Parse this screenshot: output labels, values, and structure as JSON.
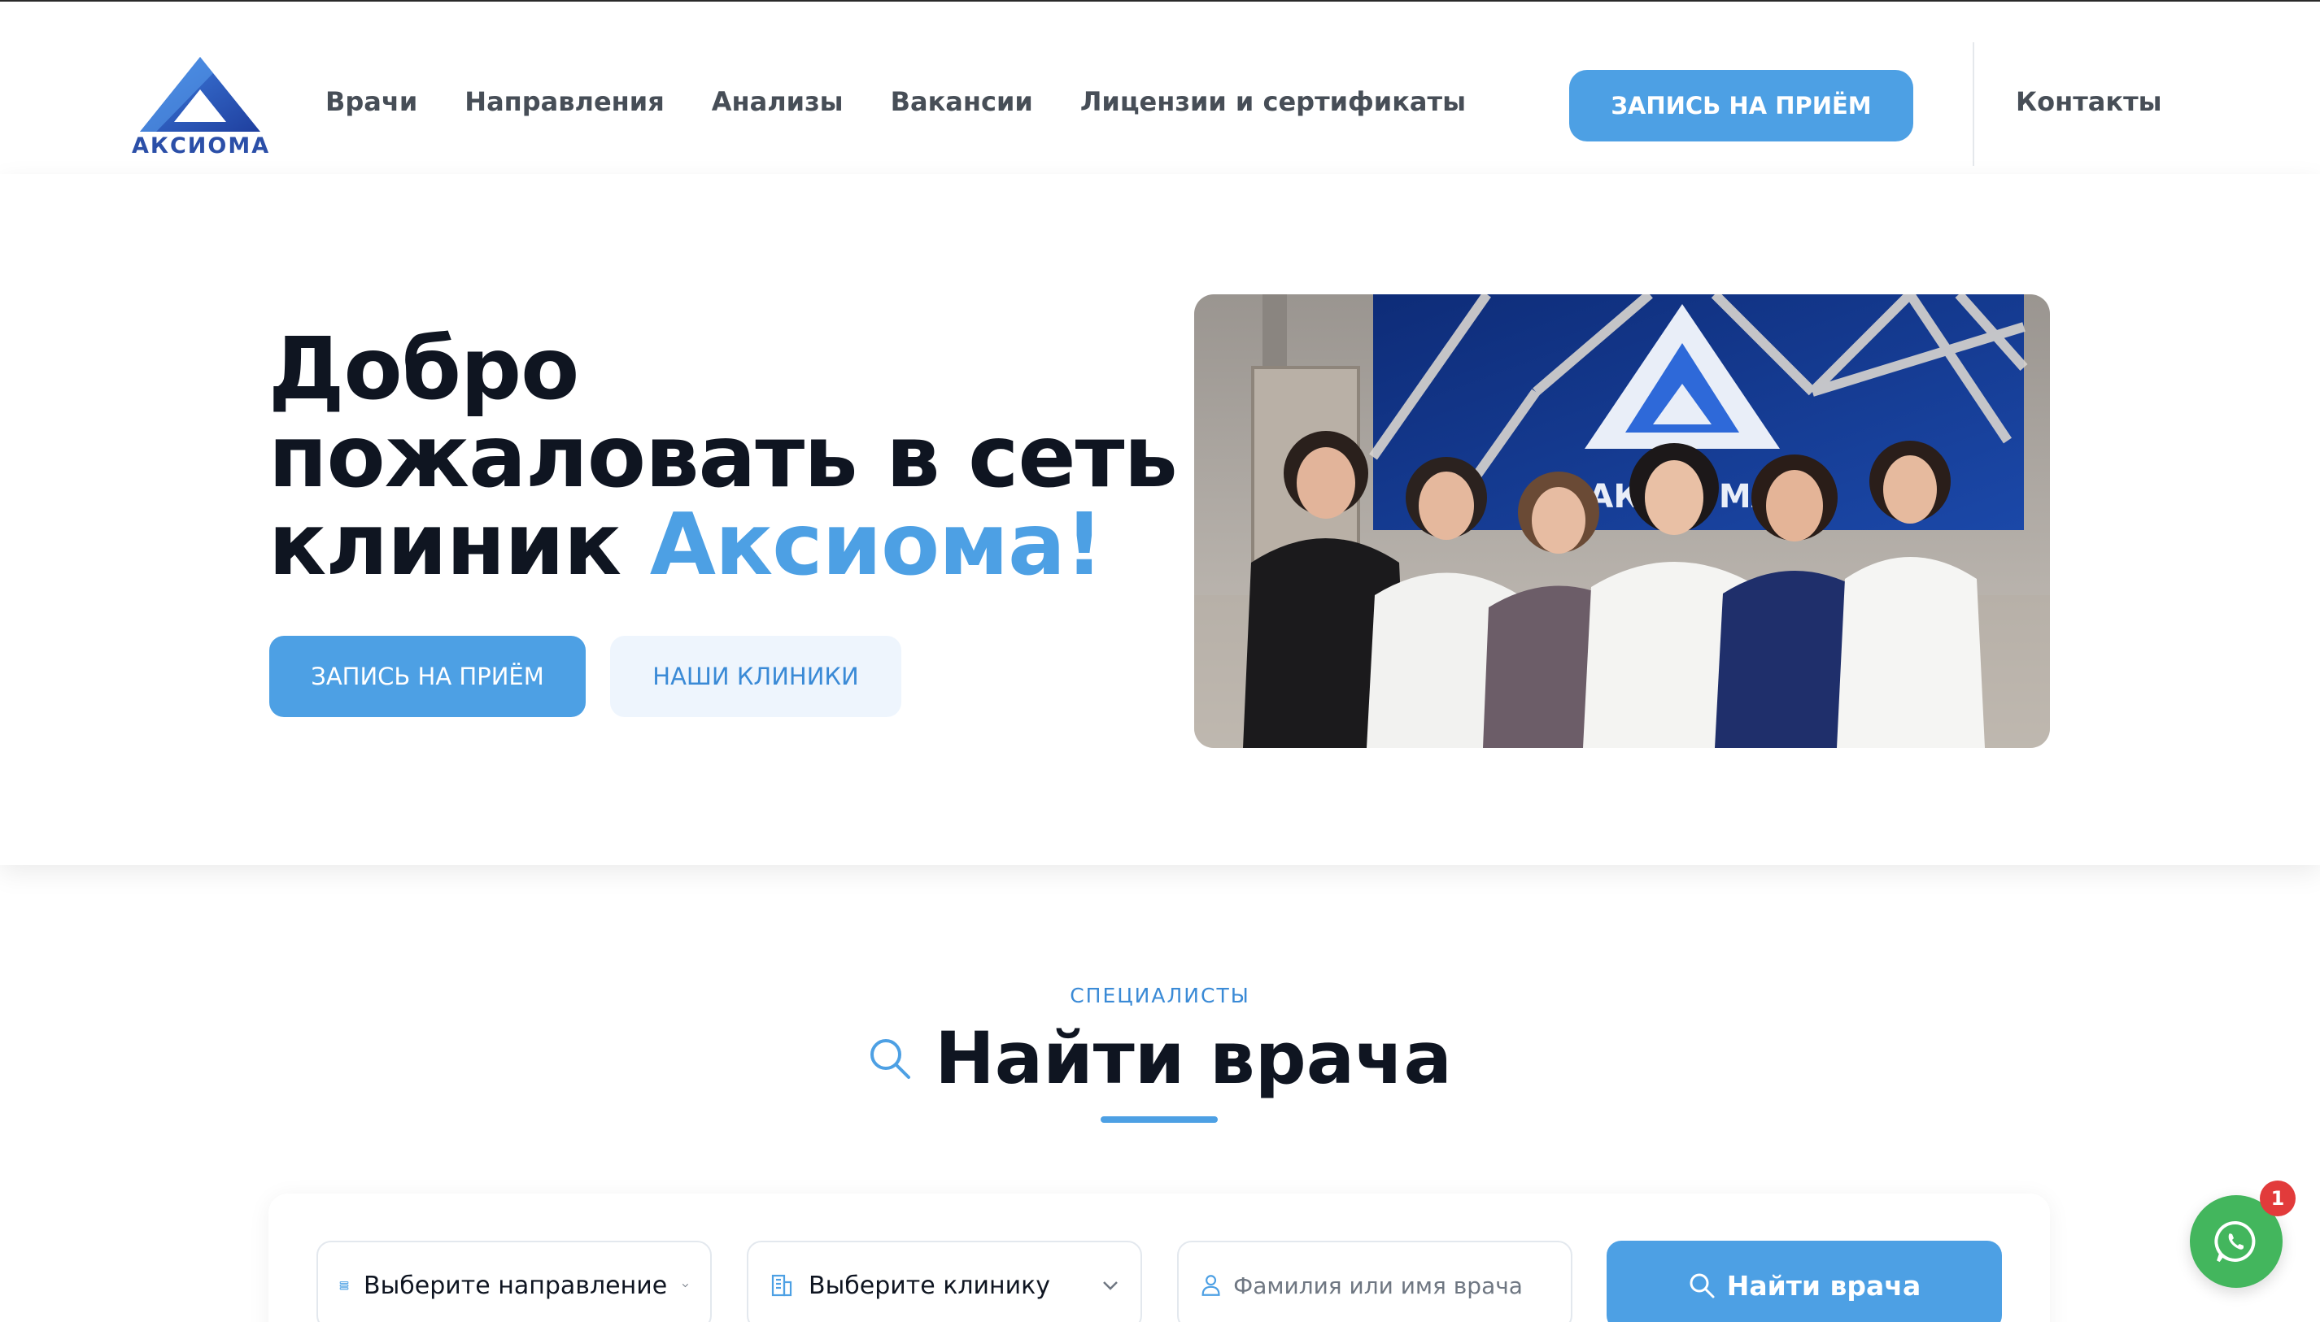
{
  "brand": {
    "name": "АКСИОМА",
    "color": "#2b4fa8"
  },
  "nav": {
    "items": [
      {
        "label": "Врачи"
      },
      {
        "label": "Направления"
      },
      {
        "label": "Анализы"
      },
      {
        "label": "Вакансии"
      },
      {
        "label": "Лицензии и сертификаты"
      }
    ],
    "cta_label": "ЗАПИСЬ НА ПРИЁМ",
    "contacts_label": "Контакты"
  },
  "hero": {
    "title_line1": "Добро",
    "title_line2": "пожаловать в сеть",
    "title_line3_prefix": "клиник ",
    "title_accent": "Аксиома!",
    "primary_button": "ЗАПИСЬ НА ПРИЁМ",
    "secondary_button": "НАШИ КЛИНИКИ",
    "photo_logo_text": "АКСИОМА"
  },
  "find_doctor": {
    "kicker": "СПЕЦИАЛИСТЫ",
    "title": "Найти врача",
    "direction_select": "Выберите направление",
    "clinic_select": "Выберите клинику",
    "name_placeholder": "Фамилия или имя врача",
    "search_button": "Найти врача"
  },
  "whatsapp": {
    "badge_count": "1",
    "color": "#43b65d"
  },
  "colors": {
    "accent": "#4da0e4",
    "dark_text": "#0f1521",
    "nav_text": "#474e57"
  }
}
